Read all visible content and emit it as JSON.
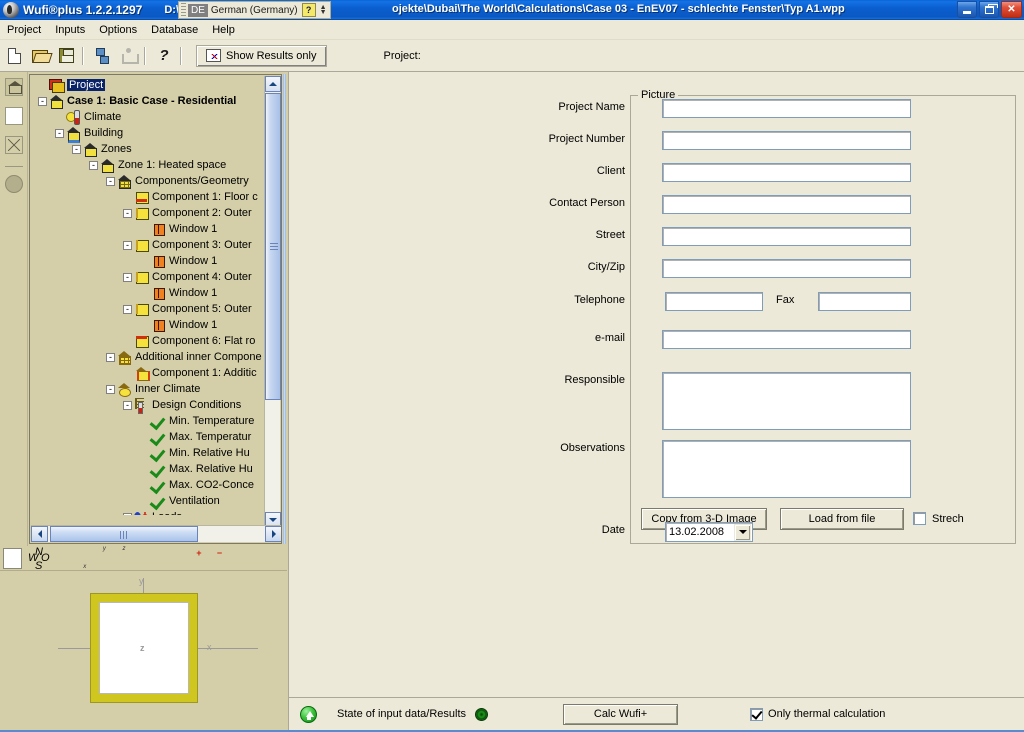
{
  "window": {
    "app_title": "Wufi®plus 1.2.2.1297",
    "path_prefix": "D:\\My I",
    "path_suffix": "ojekte\\Dubai\\The World\\Calculations\\Case 03 - EnEV07 - schlechte Fenster\\Typ A1.wpp",
    "minimize_label": "Minimize",
    "restore_label": "Restore",
    "close_label": "✕",
    "app_icon": "wufi-app-icon"
  },
  "language_bar": {
    "code": "DE",
    "name": "German (Germany)",
    "help_glyph": "?",
    "grip": "drag-grip"
  },
  "menu": {
    "items": [
      {
        "label": "Project"
      },
      {
        "label": "Inputs"
      },
      {
        "label": "Options"
      },
      {
        "label": "Database"
      },
      {
        "label": "Help"
      }
    ]
  },
  "toolbar": {
    "buttons": [
      {
        "name": "new-document-icon",
        "label": "New"
      },
      {
        "name": "open-folder-icon",
        "label": "Open"
      },
      {
        "name": "save-disk-icon",
        "label": "Save"
      },
      {
        "name": "tree-structure-icon",
        "label": "Structure"
      },
      {
        "name": "prune-tree-icon",
        "label": "Prune"
      },
      {
        "name": "help-question-icon",
        "label": "?"
      }
    ],
    "show_results_label": "Show Results only",
    "show_results_icon": "results-chart-icon",
    "project_label": "Project:"
  },
  "left_strip": {
    "buttons": [
      {
        "name": "house-view-icon",
        "label": "House view"
      },
      {
        "name": "rectangle-view-icon",
        "label": "Rectangle view"
      },
      {
        "name": "crossed-box-icon",
        "label": "Crossed box"
      },
      {
        "name": "circle-view-icon",
        "label": "Circle"
      }
    ]
  },
  "tree": {
    "nodes": [
      {
        "level": 0,
        "expander": "",
        "icon": "project-books-icon",
        "label": "Project",
        "selected": true,
        "bold": false
      },
      {
        "level": 0,
        "expander": "-",
        "icon": "house-icon",
        "label": "Case 1: Basic Case - Residential",
        "selected": false,
        "bold": true
      },
      {
        "level": 1,
        "expander": "",
        "icon": "climate-sun-icon",
        "label": "Climate",
        "selected": false,
        "bold": false
      },
      {
        "level": 1,
        "expander": "-",
        "icon": "house-blue-icon",
        "label": "Building",
        "selected": false,
        "bold": false
      },
      {
        "level": 2,
        "expander": "-",
        "icon": "house-icon",
        "label": "Zones",
        "selected": false,
        "bold": false
      },
      {
        "level": 3,
        "expander": "-",
        "icon": "house-icon",
        "label": "Zone 1: Heated space",
        "selected": false,
        "bold": false
      },
      {
        "level": 4,
        "expander": "-",
        "icon": "house-grid-icon",
        "label": "Components/Geometry",
        "selected": false,
        "bold": false
      },
      {
        "level": 5,
        "expander": "",
        "icon": "component-floor-icon",
        "label": "Component 1: Floor c",
        "selected": false,
        "bold": false
      },
      {
        "level": 5,
        "expander": "-",
        "icon": "component-wall-icon",
        "label": "Component 2: Outer",
        "selected": false,
        "bold": false
      },
      {
        "level": 6,
        "expander": "",
        "icon": "window-icon",
        "label": "Window 1",
        "selected": false,
        "bold": false
      },
      {
        "level": 5,
        "expander": "-",
        "icon": "component-wall-icon",
        "label": "Component 3: Outer",
        "selected": false,
        "bold": false
      },
      {
        "level": 6,
        "expander": "",
        "icon": "window-icon",
        "label": "Window 1",
        "selected": false,
        "bold": false
      },
      {
        "level": 5,
        "expander": "-",
        "icon": "component-wall-icon",
        "label": "Component 4: Outer",
        "selected": false,
        "bold": false
      },
      {
        "level": 6,
        "expander": "",
        "icon": "window-icon",
        "label": "Window 1",
        "selected": false,
        "bold": false
      },
      {
        "level": 5,
        "expander": "-",
        "icon": "component-wall-icon",
        "label": "Component 5: Outer",
        "selected": false,
        "bold": false
      },
      {
        "level": 6,
        "expander": "",
        "icon": "window-icon",
        "label": "Window 1",
        "selected": false,
        "bold": false
      },
      {
        "level": 5,
        "expander": "",
        "icon": "component-roof-icon",
        "label": "Component 6: Flat ro",
        "selected": false,
        "bold": false
      },
      {
        "level": 4,
        "expander": "-",
        "icon": "additional-inner-icon",
        "label": "Additional inner Compone",
        "selected": false,
        "bold": false
      },
      {
        "level": 5,
        "expander": "",
        "icon": "additional-comp-icon",
        "label": "Component 1: Additic",
        "selected": false,
        "bold": false
      },
      {
        "level": 4,
        "expander": "-",
        "icon": "inner-climate-icon",
        "label": "Inner Climate",
        "selected": false,
        "bold": false
      },
      {
        "level": 5,
        "expander": "-",
        "icon": "design-conditions-icon",
        "label": "Design Conditions",
        "selected": false,
        "bold": false
      },
      {
        "level": 6,
        "expander": "",
        "icon": "check-icon",
        "label": "Min. Temperature",
        "selected": false,
        "bold": false
      },
      {
        "level": 6,
        "expander": "",
        "icon": "check-icon",
        "label": "Max. Temperatur",
        "selected": false,
        "bold": false
      },
      {
        "level": 6,
        "expander": "",
        "icon": "check-icon",
        "label": "Min. Relative Hu",
        "selected": false,
        "bold": false
      },
      {
        "level": 6,
        "expander": "",
        "icon": "check-icon",
        "label": "Max. Relative Hu",
        "selected": false,
        "bold": false
      },
      {
        "level": 6,
        "expander": "",
        "icon": "check-icon",
        "label": "Max. CO2-Conce",
        "selected": false,
        "bold": false
      },
      {
        "level": 6,
        "expander": "",
        "icon": "check-icon",
        "label": "Ventilation",
        "selected": false,
        "bold": false
      },
      {
        "level": 5,
        "expander": "-",
        "icon": "loads-icon",
        "label": "Loads",
        "selected": false,
        "bold": false
      }
    ],
    "vertical_scrollbar": {
      "up": "scroll-up-arrow",
      "down": "scroll-down-arrow"
    },
    "horizontal_scrollbar": {
      "left": "scroll-left-arrow",
      "right": "scroll-right-arrow"
    }
  },
  "view_toolbar": {
    "buttons": [
      {
        "name": "axes-icon",
        "label": "Axes"
      },
      {
        "name": "compass-icon",
        "label": "Compass"
      },
      {
        "name": "rotate-x-icon",
        "label": "Rotate X"
      },
      {
        "name": "rotate-y-icon",
        "label": "Rotate Y"
      },
      {
        "name": "rotate-z-icon",
        "label": "Rotate Z"
      },
      {
        "name": "solid-view-icon",
        "label": "Solid view"
      },
      {
        "name": "zoom-in-icon",
        "label": "Zoom in"
      },
      {
        "name": "zoom-out-icon",
        "label": "Zoom out"
      },
      {
        "name": "layout-icon",
        "label": "Layout"
      }
    ]
  },
  "viewport": {
    "axis_x_label": "x",
    "axis_y_label": "y",
    "center_label": "z"
  },
  "form": {
    "fields": [
      {
        "label": "Project Name",
        "value": "",
        "name": "project-name-input"
      },
      {
        "label": "Project Number",
        "value": "",
        "name": "project-number-input"
      },
      {
        "label": "Client",
        "value": "",
        "name": "client-input"
      },
      {
        "label": "Contact Person",
        "value": "",
        "name": "contact-person-input"
      },
      {
        "label": "Street",
        "value": "",
        "name": "street-input"
      },
      {
        "label": "City/Zip",
        "value": "",
        "name": "city-zip-input"
      }
    ],
    "telephone_label": "Telephone",
    "telephone_value": "",
    "fax_label": "Fax",
    "fax_value": "",
    "email_label": "e-mail",
    "email_value": "",
    "responsible_label": "Responsible",
    "responsible_value": "",
    "observations_label": "Observations",
    "observations_value": "",
    "date_label": "Date",
    "date_value": "13.02.2008"
  },
  "picture": {
    "legend": "Picture",
    "copy_3d_label": "Copy from 3-D Image",
    "load_file_label": "Load from file",
    "stretch_label": "Strech",
    "stretch_checked": false
  },
  "status": {
    "up_icon": "green-up-arrow-icon",
    "state_label": "State of input data/Results",
    "state_indicator": "green-target-indicator",
    "calc_label": "Calc Wufi+",
    "only_thermal_label": "Only thermal calculation",
    "only_thermal_checked": true
  },
  "colors": {
    "title_blue": "#0b5fd0",
    "panel_bg": "#ece9d8",
    "tree_bg": "#d4cfa8",
    "accent_yellow": "#cfc620",
    "status_green": "#2fc02f"
  }
}
